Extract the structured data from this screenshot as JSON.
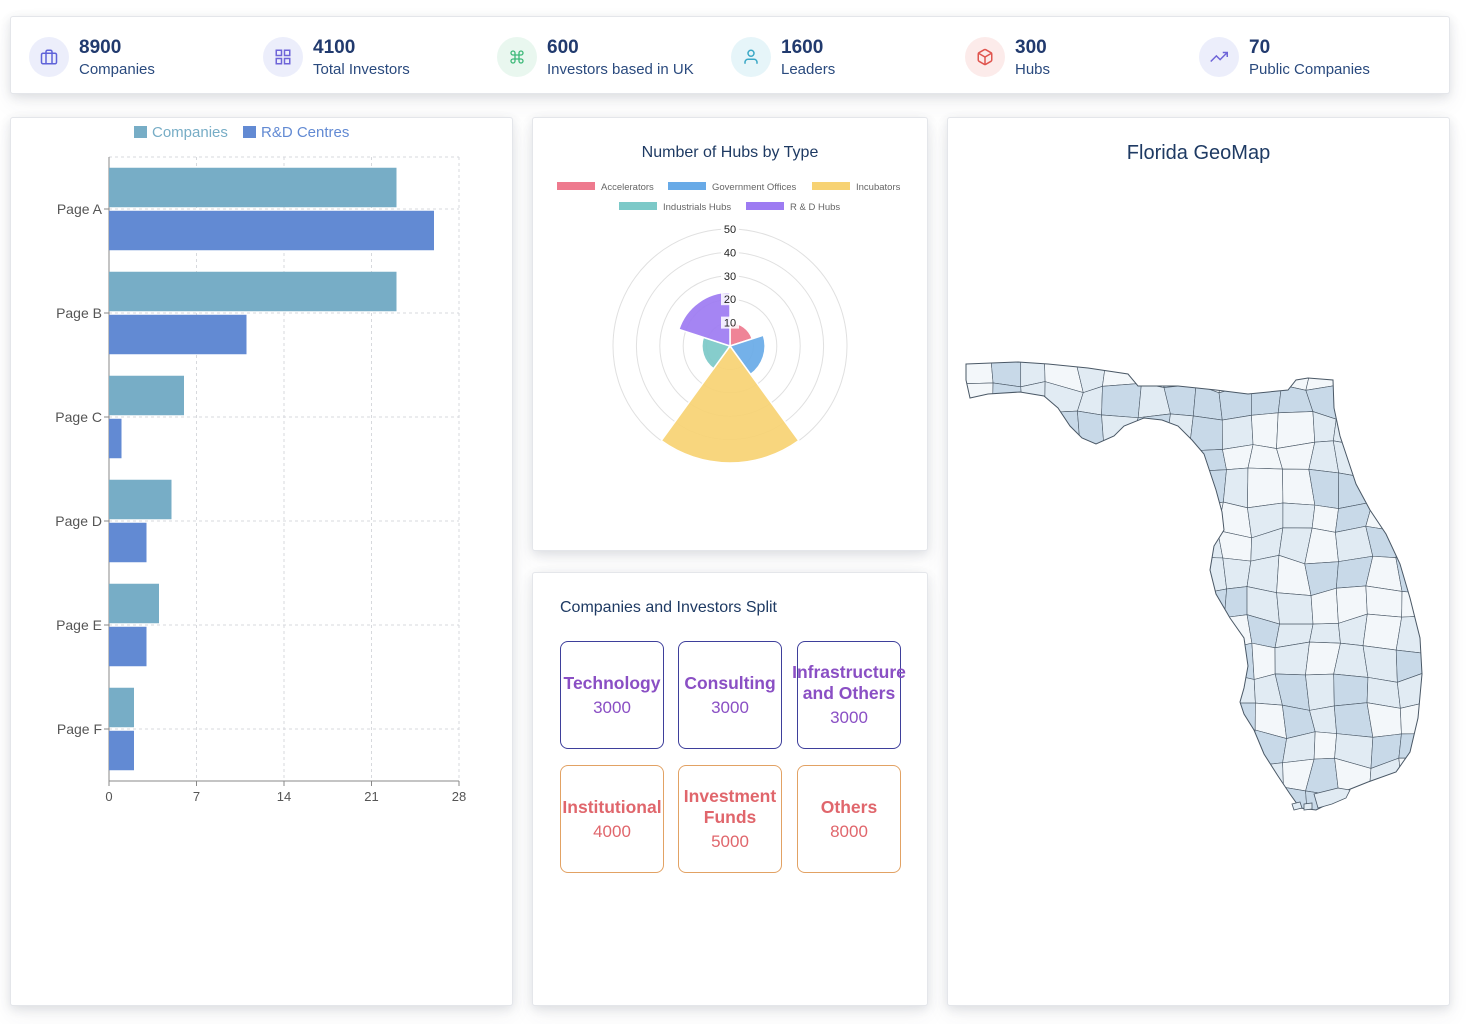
{
  "stats": [
    {
      "value": "8900",
      "label": "Companies",
      "icon": "briefcase-icon",
      "color": "#5f63d9",
      "bg": "#eceefb"
    },
    {
      "value": "4100",
      "label": "Total Investors",
      "icon": "grid-icon",
      "color": "#6e64d8",
      "bg": "#eceefb"
    },
    {
      "value": "600",
      "label": "Investors based in UK",
      "icon": "command-icon",
      "color": "#3fb97a",
      "bg": "#e9f7ef"
    },
    {
      "value": "1600",
      "label": "Leaders",
      "icon": "user-icon",
      "color": "#3aa8c6",
      "bg": "#e6f5f9"
    },
    {
      "value": "300",
      "label": "Hubs",
      "icon": "box-icon",
      "color": "#e0554f",
      "bg": "#fcebea"
    },
    {
      "value": "70",
      "label": "Public Companies",
      "icon": "trending-up-icon",
      "color": "#6e64d8",
      "bg": "#eceefb"
    }
  ],
  "bar_chart": {
    "legend": [
      {
        "name": "Companies",
        "color": "#77adc6"
      },
      {
        "name": "R&D Centres",
        "color": "#628ad3"
      }
    ]
  },
  "chart_data": [
    {
      "type": "bar",
      "orientation": "horizontal",
      "categories": [
        "Page A",
        "Page B",
        "Page C",
        "Page D",
        "Page E",
        "Page F"
      ],
      "series": [
        {
          "name": "Companies",
          "values": [
            23,
            23,
            6,
            5,
            4,
            2
          ]
        },
        {
          "name": "R&D Centres",
          "values": [
            26,
            11,
            1,
            3,
            3,
            2
          ]
        }
      ],
      "xlim": [
        0,
        28
      ],
      "xticks": [
        "0",
        "7",
        "14",
        "21",
        "28"
      ],
      "grid": true,
      "legend_position": "top"
    },
    {
      "type": "polar-area",
      "title": "Number of Hubs by Type",
      "categories": [
        "Accelerators",
        "Government Offices",
        "Incubators",
        "Industrials Hubs",
        "R & D Hubs"
      ],
      "values": [
        10,
        15,
        50,
        12,
        23
      ],
      "colors": [
        "#ee7a8e",
        "#68aae7",
        "#f7d273",
        "#7cc9c8",
        "#9d7bf2"
      ],
      "rlim": [
        0,
        50
      ],
      "rticks": [
        "10",
        "20",
        "30",
        "40",
        "50"
      ],
      "legend_position": "top"
    }
  ],
  "split": {
    "title": "Companies and Investors Split",
    "tiles": [
      {
        "name": "Technology",
        "value": "3000"
      },
      {
        "name": "Consulting",
        "value": "3000"
      },
      {
        "name": "Infrastructure and Others",
        "value": "3000"
      },
      {
        "name": "Institutional",
        "value": "4000"
      },
      {
        "name": "Investment Funds",
        "value": "5000"
      },
      {
        "name": "Others",
        "value": "8000"
      }
    ]
  },
  "map": {
    "title": "Florida GeoMap",
    "fill_colors": [
      "#c8d9e8",
      "#e1ebf3",
      "#f3f7fa"
    ],
    "stroke_color": "#4a5866"
  }
}
